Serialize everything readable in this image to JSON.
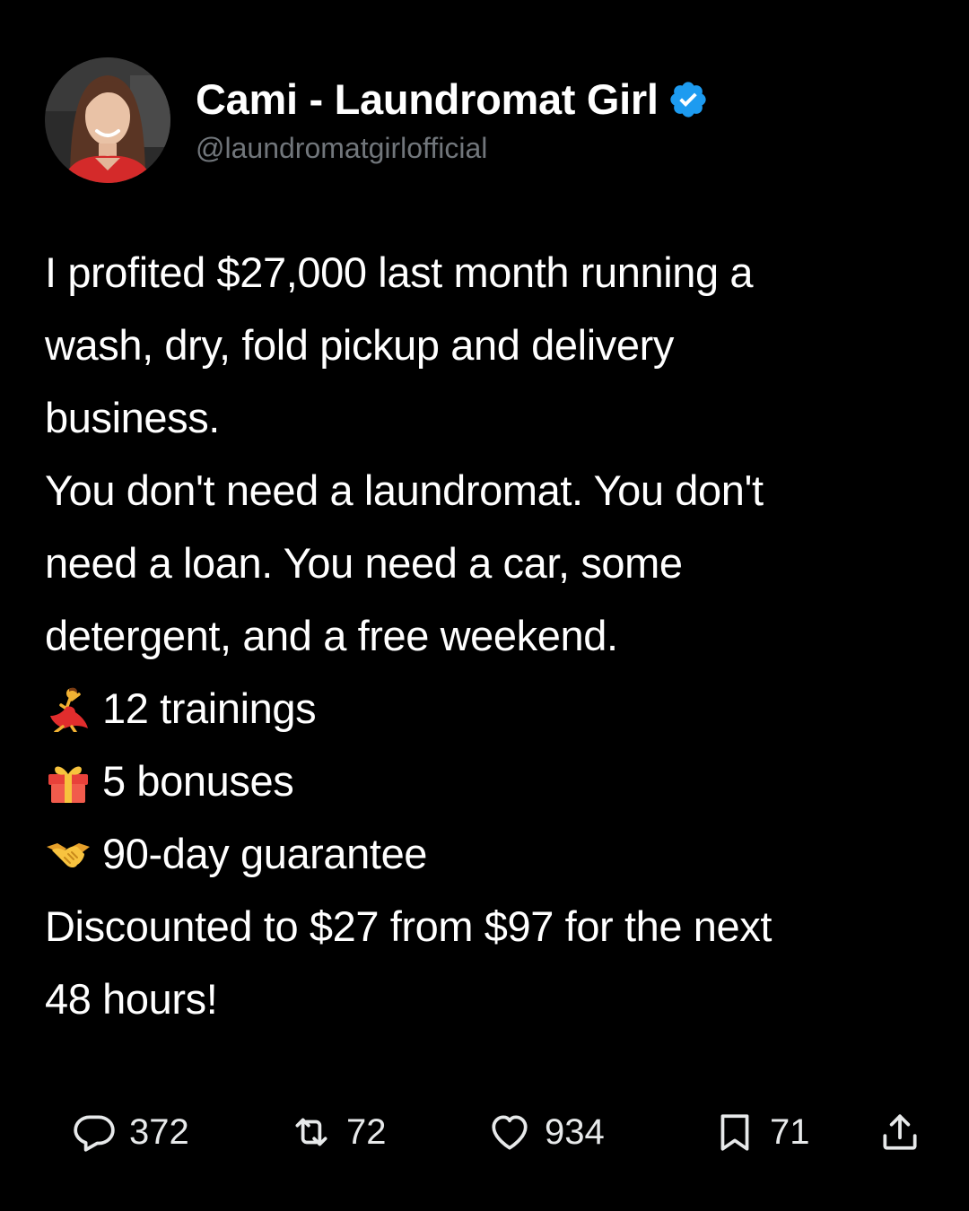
{
  "author": {
    "display_name": "Cami - Laundromat Girl",
    "handle": "@laundromatgirlofficial",
    "verified": true,
    "verified_color": "#1d9bf0"
  },
  "post": {
    "paragraphs": [
      "I profited $27,000 last month running a",
      "wash, dry, fold pickup and delivery",
      "business.",
      "You don't need a laundromat. You don't",
      "need a loan. You need a car, some",
      "detergent, and a free weekend."
    ],
    "list": [
      {
        "icon": "dancer-emoji",
        "text": "12 trainings"
      },
      {
        "icon": "gift-emoji",
        "text": "5 bonuses"
      },
      {
        "icon": "handshake-emoji",
        "text": "90-day guarantee"
      }
    ],
    "closing": [
      "Discounted to $27 from $97 for the next",
      "48 hours!"
    ]
  },
  "actions": {
    "replies": "372",
    "reposts": "72",
    "likes": "934",
    "bookmarks": "71"
  },
  "colors": {
    "background": "#000000",
    "text": "#ffffff",
    "secondary_text": "#71767b",
    "action_text": "#e7e9ea"
  }
}
